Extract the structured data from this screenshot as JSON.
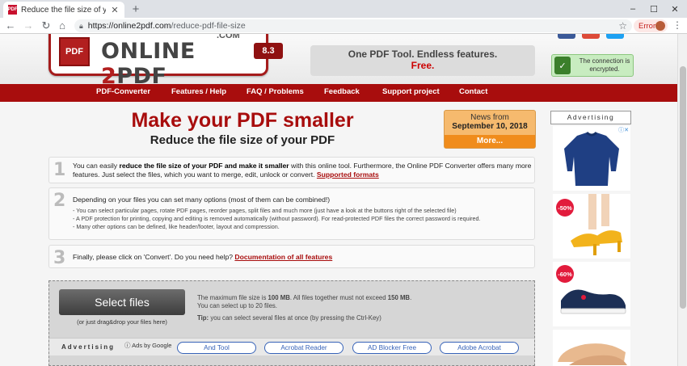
{
  "browser": {
    "tab_title": "Reduce the file size of your PDF",
    "favicon_text": "PDF",
    "url_domain": "https://online2pdf.com",
    "url_path": "/reduce-pdf-file-size",
    "error_label": "Error"
  },
  "header": {
    "logo_pdf": "PDF",
    "logo_online": "ONLINE",
    "logo_two": "2",
    "logo_pdf_word": "PDF",
    "logo_com": ".COM",
    "version": "8.3",
    "tagline_1": "One PDF Tool. Endless features.",
    "tagline_2": "Free.",
    "encrypted": "The connection is encrypted."
  },
  "nav": [
    "PDF-Converter",
    "Features / Help",
    "FAQ / Problems",
    "Feedback",
    "Support project",
    "Contact"
  ],
  "main": {
    "title": "Make your PDF smaller",
    "subtitle": "Reduce the file size of your PDF"
  },
  "news": {
    "label": "News from",
    "date": "September 10, 2018",
    "more": "More..."
  },
  "steps": {
    "s1_num": "1",
    "s1_a": "You can easily ",
    "s1_b": "reduce the file size of your PDF and make it smaller",
    "s1_c": " with this online tool. Furthermore, the Online PDF Converter offers many more features. Just select the files, which you want to merge, edit, unlock or convert. ",
    "s1_link": "Supported formats",
    "s2_num": "2",
    "s2_main": "Depending on your files you can set many options (most of them can be combined!)",
    "s2_b1": "- You can select particular pages, rotate PDF pages, reorder pages, split files and much more (just have a look at the buttons right of the selected file)",
    "s2_b2": "- A PDF protection for printing, copying and editing is removed automatically (without password). For read-protected PDF files the correct password is required.",
    "s2_b3": "- Many other options can be defined, like header/footer, layout and compression.",
    "s3_num": "3",
    "s3_text": "Finally, please click on 'Convert'. Do you need help? ",
    "s3_link": "Documentation of all features"
  },
  "upload": {
    "select_label": "Select files",
    "drag_note": "(or just drag&drop your files here)",
    "limits_a": "The maximum file size is ",
    "limits_b": "100 MB",
    "limits_c": ". All files together must not exceed ",
    "limits_d": "150 MB",
    "limits_e": ".",
    "limits_2": "You can select up to 20 files.",
    "tip_label": "Tip:",
    "tip_text": " you can select several files at once (by pressing the Ctrl-Key)"
  },
  "ads": {
    "label": "Advertising",
    "by_google": "Ads by Google",
    "pills": [
      "And Tool",
      "Acrobat Reader",
      "AD Blocker Free",
      "Adobe Acrobat"
    ],
    "side_label": "Advertising",
    "badge_1": "-50%",
    "badge_2": "-60%"
  },
  "colors": {
    "brand_red": "#a80d0d",
    "news_orange": "#f08c1c",
    "link_blue": "#3763b8"
  }
}
